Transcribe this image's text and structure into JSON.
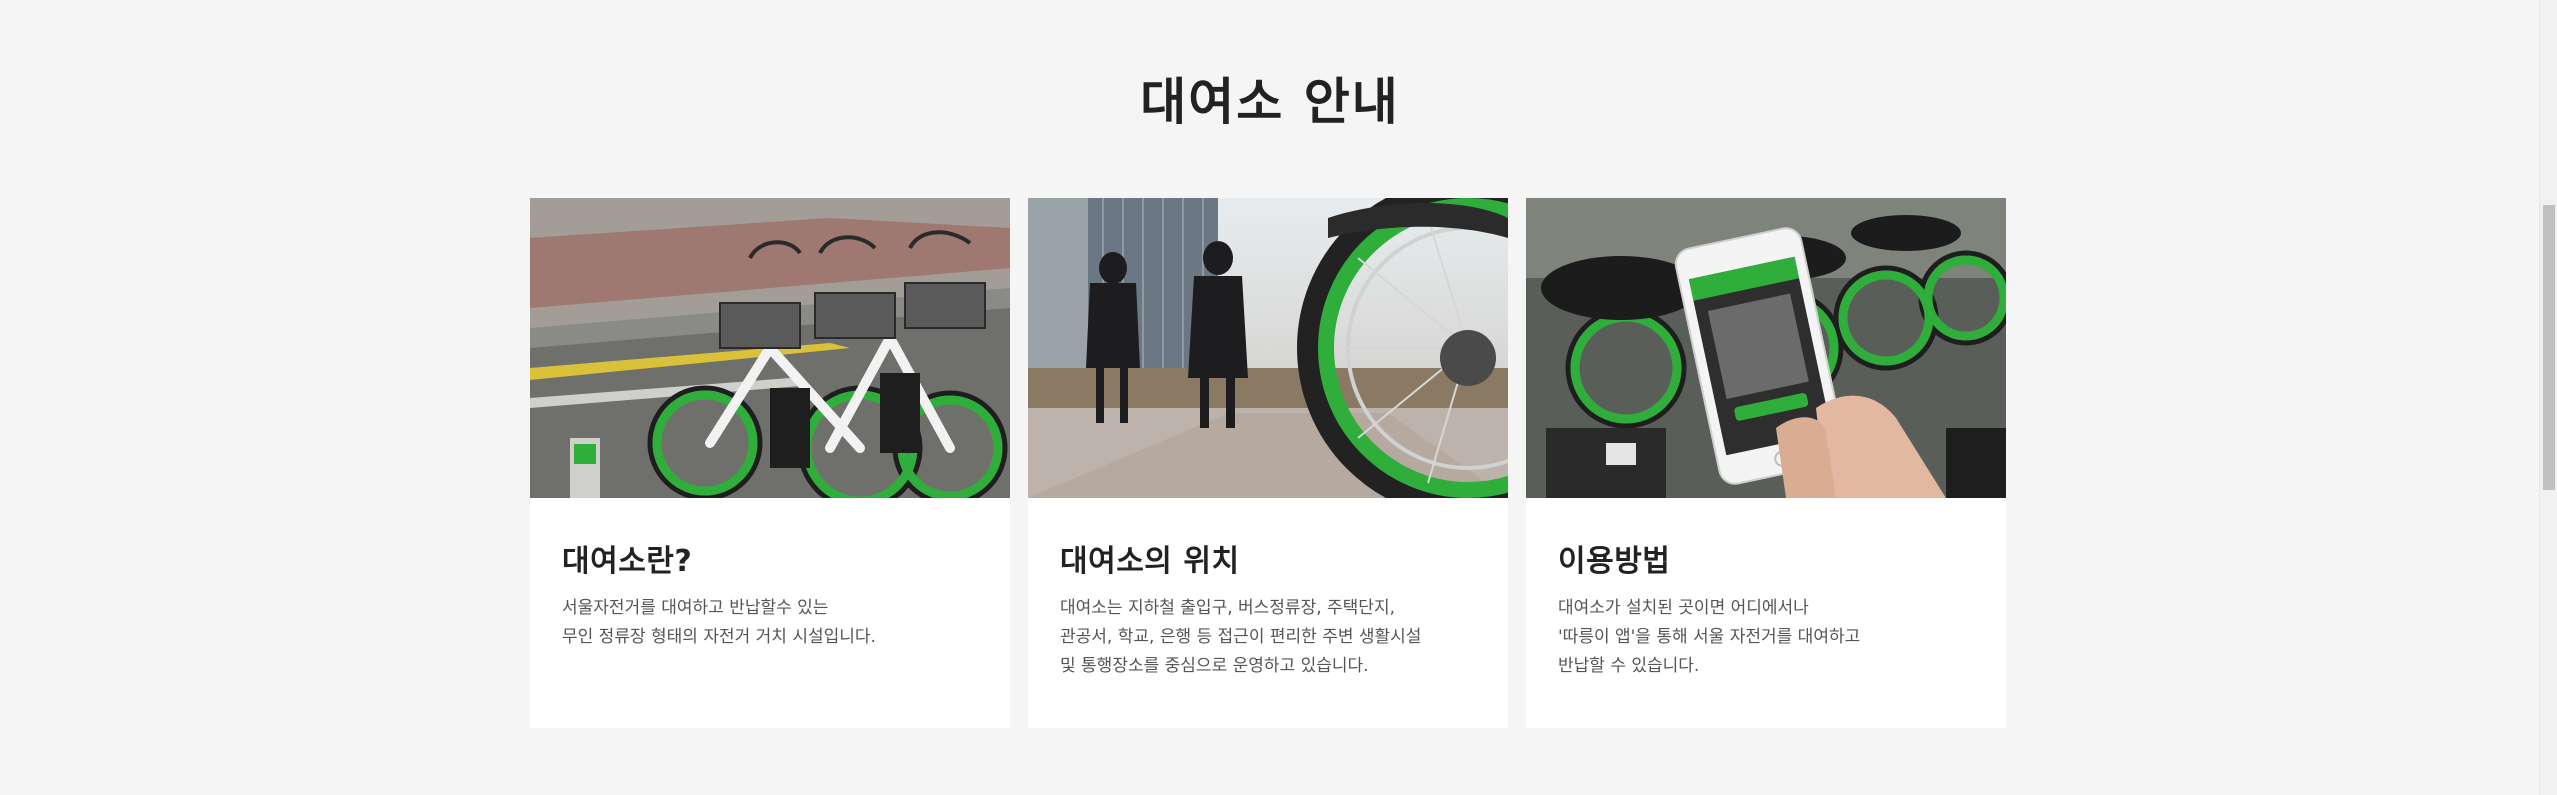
{
  "section": {
    "title": "대여소 안내"
  },
  "cards": [
    {
      "image": "bikes-at-station-photo",
      "title": "대여소란?",
      "description": "서울자전거를 대여하고 반납할수 있는\n무인 정류장 형태의 자전거 거치 시설입니다."
    },
    {
      "image": "people-walking-past-bikes-photo",
      "title": "대여소의 위치",
      "description": "대여소는 지하철 출입구, 버스정류장, 주택단지,\n관공서, 학교, 은행 등 접근이 편리한 주변 생활시설\n및 통행장소를 중심으로 운영하고 있습니다."
    },
    {
      "image": "phone-app-unlocking-bike-photo",
      "title": "이용방법",
      "description": "대여소가 설치된 곳이면 어디에서나\n'따릉이 앱'을 통해 서울 자전거를 대여하고\n반납할 수 있습니다."
    }
  ],
  "colors": {
    "background": "#f5f5f5",
    "card": "#ffffff",
    "title": "#222222",
    "text": "#555555",
    "bike_green": "#2fae3b"
  }
}
